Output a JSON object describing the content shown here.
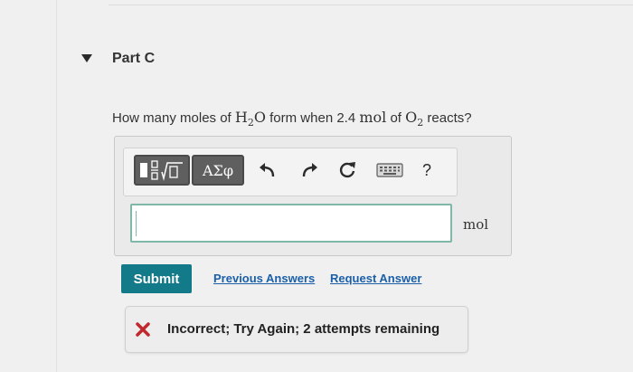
{
  "part": {
    "title": "Part C"
  },
  "question": {
    "prefix": "How many moles of ",
    "h2o_main": "H",
    "h2o_sub": "2",
    "h2o_tail": "O",
    "middle": " form when 2.4 ",
    "unit_mol": "mol",
    "of": " of ",
    "o2_main": "O",
    "o2_sub": "2",
    "suffix": " reacts?"
  },
  "toolbar": {
    "greek_label": "ΑΣφ",
    "help_label": "?"
  },
  "answer": {
    "value": "",
    "unit": "mol"
  },
  "actions": {
    "submit_label": "Submit",
    "previous_answers_label": "Previous Answers",
    "request_answer_label": "Request Answer"
  },
  "feedback": {
    "message": "Incorrect; Try Again; 2 attempts remaining",
    "icon": "x-icon",
    "color": "#c0282d"
  },
  "colors": {
    "submit_bg": "#137a8a",
    "link": "#1a5fa8",
    "input_border": "#7fb7a8"
  }
}
